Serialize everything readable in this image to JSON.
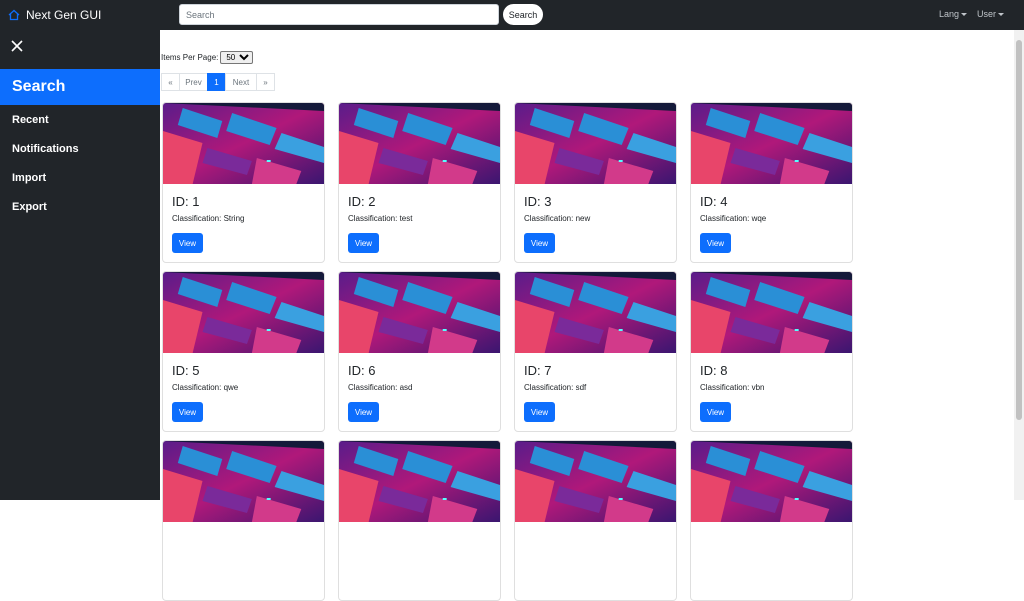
{
  "header": {
    "brand": "Next Gen GUI",
    "search_placeholder": "Search",
    "search_button": "Search",
    "menus": [
      "Lang",
      "User"
    ]
  },
  "sidebar": {
    "active": "Search",
    "items": [
      "Recent",
      "Notifications",
      "Import",
      "Export"
    ]
  },
  "main": {
    "items_per_page_label": "Items Per Page:",
    "items_per_page_value": "50",
    "pagination": [
      "«",
      "Prev",
      "1",
      "Next",
      "»"
    ],
    "cards": [
      {
        "id": "ID: 1",
        "classification": "Classification: String",
        "button": "View"
      },
      {
        "id": "ID: 2",
        "classification": "Classification: test",
        "button": "View"
      },
      {
        "id": "ID: 3",
        "classification": "Classification: new",
        "button": "View"
      },
      {
        "id": "ID: 4",
        "classification": "Classification: wqe",
        "button": "View"
      },
      {
        "id": "ID: 5",
        "classification": "Classification: qwe",
        "button": "View"
      },
      {
        "id": "ID: 6",
        "classification": "Classification: asd",
        "button": "View"
      },
      {
        "id": "ID: 7",
        "classification": "Classification: sdf",
        "button": "View"
      },
      {
        "id": "ID: 8",
        "classification": "Classification: vbn",
        "button": "View"
      }
    ]
  },
  "colors": {
    "topbar": "#212529",
    "primary": "#0d6efd"
  }
}
